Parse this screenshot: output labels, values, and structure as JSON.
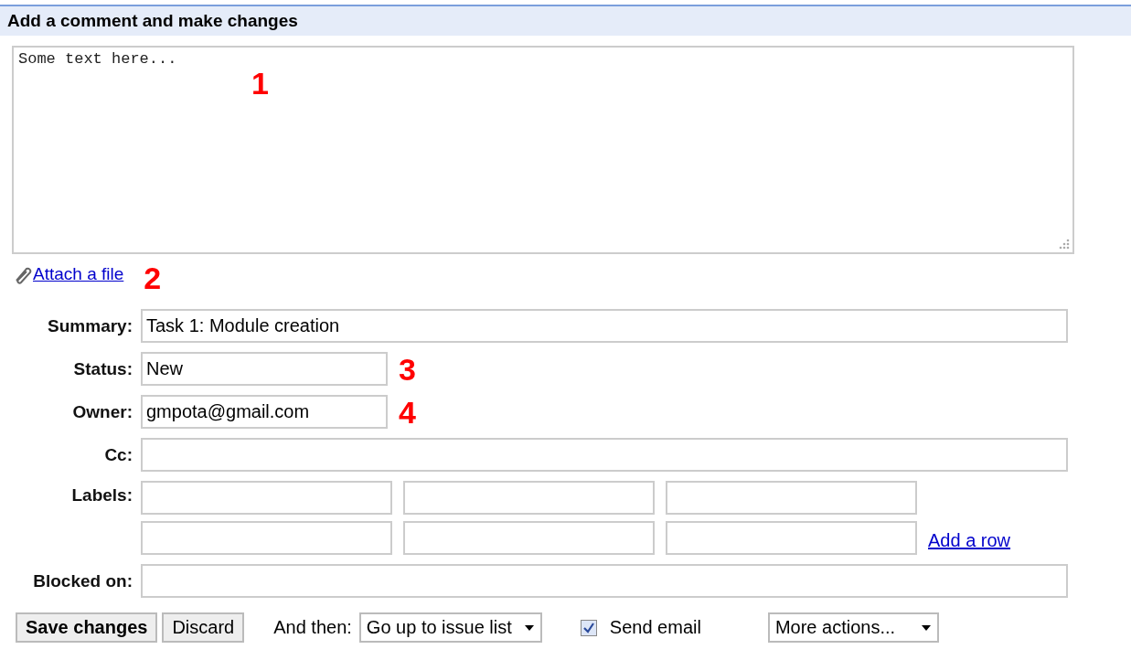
{
  "section_title": "Add a comment and make changes",
  "comment": {
    "value": "Some text here...",
    "annotation": "1"
  },
  "attach_link": "Attach a file",
  "attach_annotation": "2",
  "fields": [
    {
      "kind": "wide",
      "label": "Summary:",
      "value": "Task 1: Module creation"
    },
    {
      "kind": "short",
      "label": "Status:",
      "value": "New",
      "annotation": "3"
    },
    {
      "kind": "short",
      "label": "Owner:",
      "value": "gmpota@gmail.com",
      "annotation": "4"
    },
    {
      "kind": "wide",
      "label": "Cc:"
    },
    {
      "kind": "labels",
      "label": "Labels:",
      "add_row": "Add a row"
    },
    {
      "kind": "wide",
      "label": "Blocked on:"
    }
  ],
  "actions": {
    "save": "Save changes",
    "discard": "Discard",
    "then_label": "And then:",
    "then_value": "Go up to issue list",
    "send_email": {
      "label": "Send email",
      "checked": true
    },
    "more": "More actions..."
  }
}
